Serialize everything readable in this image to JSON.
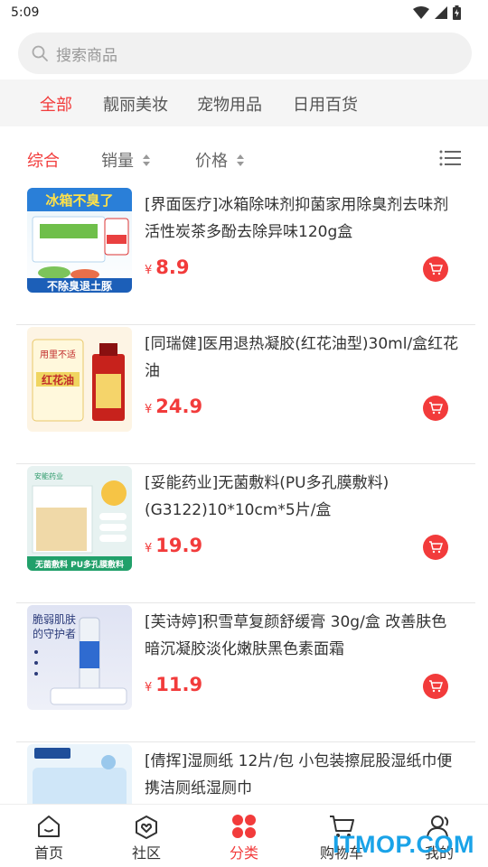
{
  "status": {
    "time": "5:09"
  },
  "search": {
    "placeholder": "搜索商品"
  },
  "categories": [
    {
      "label": "全部",
      "active": true
    },
    {
      "label": "靓丽美妆"
    },
    {
      "label": "宠物用品"
    },
    {
      "label": "日用百货"
    }
  ],
  "sort": {
    "overall": "综合",
    "sales": "销量",
    "price": "价格"
  },
  "products": [
    {
      "title": "[界面医疗]冰箱除味剂抑菌家用除臭剂去味剂活性炭茶多酚去除异味120g盒",
      "currency": "¥",
      "price": "8.9",
      "thumb_top": "冰箱不臭了",
      "thumb_bottom": "不除臭退土豚"
    },
    {
      "title": "[同瑞健]医用退热凝胶(红花油型)30ml/盒红花油",
      "currency": "¥",
      "price": "24.9",
      "thumb_top": "红花油",
      "thumb_bottom": ""
    },
    {
      "title": "[妥能药业]无菌敷料(PU多孔膜敷料)(G3122)10*10cm*5片/盒",
      "currency": "¥",
      "price": "19.9",
      "thumb_top": "安能药业",
      "thumb_bottom": "无菌敷料 PU多孔膜敷料"
    },
    {
      "title": "[芙诗婷]积雪草复颜舒缓膏 30g/盒 改善肤色暗沉凝胶淡化嫩肤黑色素面霜",
      "currency": "¥",
      "price": "11.9",
      "thumb_top": "脆弱肌肤的守护者",
      "thumb_bottom": ""
    },
    {
      "title": "[倩挥]湿厕纸 12片/包 小包装擦屁股湿纸巾便携洁厕纸湿厕巾",
      "currency": "¥",
      "price": "",
      "thumb_top": "",
      "thumb_bottom": ""
    }
  ],
  "tabbar": [
    {
      "label": "首页",
      "icon": "home-icon"
    },
    {
      "label": "社区",
      "icon": "community-icon"
    },
    {
      "label": "分类",
      "icon": "category-icon",
      "active": true
    },
    {
      "label": "购物车",
      "icon": "cart-icon"
    },
    {
      "label": "我的",
      "icon": "user-icon"
    }
  ],
  "watermark": "ITMOP.COM",
  "colors": {
    "accent": "#f23b3b",
    "watermark": "#1aa3e8"
  }
}
